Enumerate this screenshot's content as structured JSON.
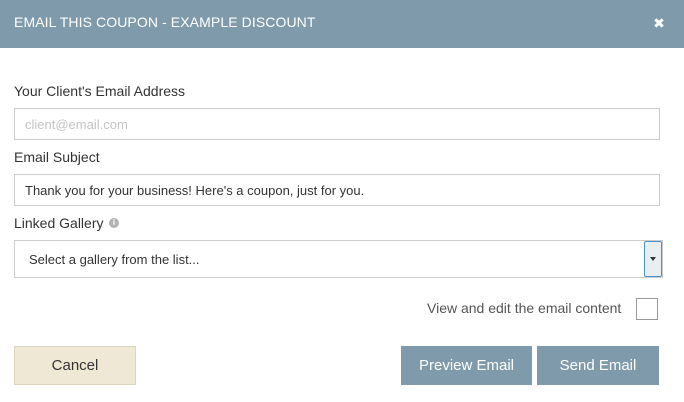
{
  "dialog": {
    "title": "EMAIL THIS COUPON - EXAMPLE DISCOUNT",
    "close_icon": "close-icon"
  },
  "form": {
    "email": {
      "label": "Your Client's Email Address",
      "value": "",
      "placeholder": "client@email.com"
    },
    "subject": {
      "label": "Email Subject",
      "value": "Thank you for your business! Here's a coupon, just for you.",
      "placeholder": ""
    },
    "gallery": {
      "label": "Linked Gallery",
      "info_icon": "info-icon",
      "selected": "Select a gallery from the list..."
    },
    "edit_content": {
      "label": "View and edit the email content",
      "checked": false
    }
  },
  "actions": {
    "cancel_label": "Cancel",
    "preview_label": "Preview Email",
    "send_label": "Send Email"
  },
  "colors": {
    "header": "#7f9bab",
    "primary_button": "#7f9bab",
    "cancel_button": "#efe8d4"
  }
}
